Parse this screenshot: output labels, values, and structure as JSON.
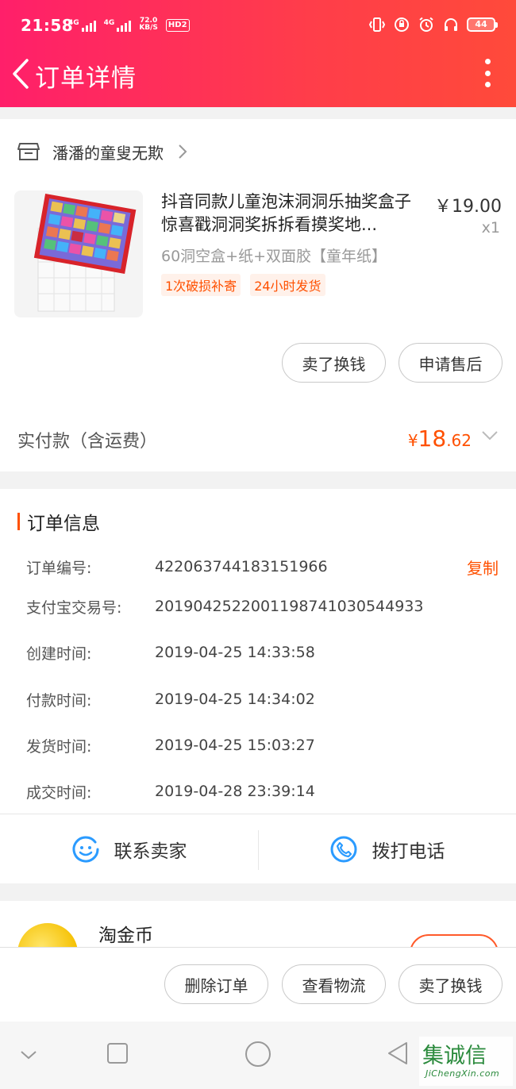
{
  "status_bar": {
    "time": "21:58",
    "net1": "4G",
    "net2": "4G",
    "speed_value": "72.0",
    "speed_unit": "KB/S",
    "hd_label": "HD2",
    "battery_level": "44"
  },
  "nav": {
    "title": "订单详情"
  },
  "shop": {
    "name": "潘潘的童叟无欺"
  },
  "product": {
    "title": "抖音同款儿童泡沫洞洞乐抽奖盒子惊喜戳洞洞奖拆拆看摸奖地...",
    "price": "￥19.00",
    "quantity": "x1",
    "spec": "60洞空盒+纸+双面胶【童年纸】",
    "tags": [
      "1次破损补寄",
      "24小时发货"
    ]
  },
  "item_actions": {
    "sell": "卖了换钱",
    "after_sale": "申请售后"
  },
  "payment": {
    "label": "实付款（含运费）",
    "currency": "¥",
    "int": "18",
    "dec": ".62"
  },
  "order_info": {
    "title": "订单信息",
    "copy": "复制",
    "rows": [
      {
        "label": "订单编号:",
        "value": "422063744183151966"
      },
      {
        "label": "支付宝交易号:",
        "value": "2019042522001198741030544933"
      },
      {
        "label": "创建时间:",
        "value": "2019-04-25 14:33:58"
      },
      {
        "label": "付款时间:",
        "value": "2019-04-25 14:34:02"
      },
      {
        "label": "发货时间:",
        "value": "2019-04-25 15:03:27"
      },
      {
        "label": "成交时间:",
        "value": "2019-04-28 23:39:14"
      }
    ]
  },
  "contact": {
    "seller": "联系卖家",
    "call": "拨打电话"
  },
  "coins": {
    "label": "淘金币"
  },
  "bottom_actions": {
    "delete": "删除订单",
    "logistics": "查看物流",
    "sell": "卖了换钱"
  },
  "watermark": {
    "text": "集诚信",
    "url": "JiChengXin.com"
  },
  "colors": {
    "accent": "#ff5000",
    "header_start": "#ff1f6a",
    "header_end": "#ff4a3a"
  }
}
